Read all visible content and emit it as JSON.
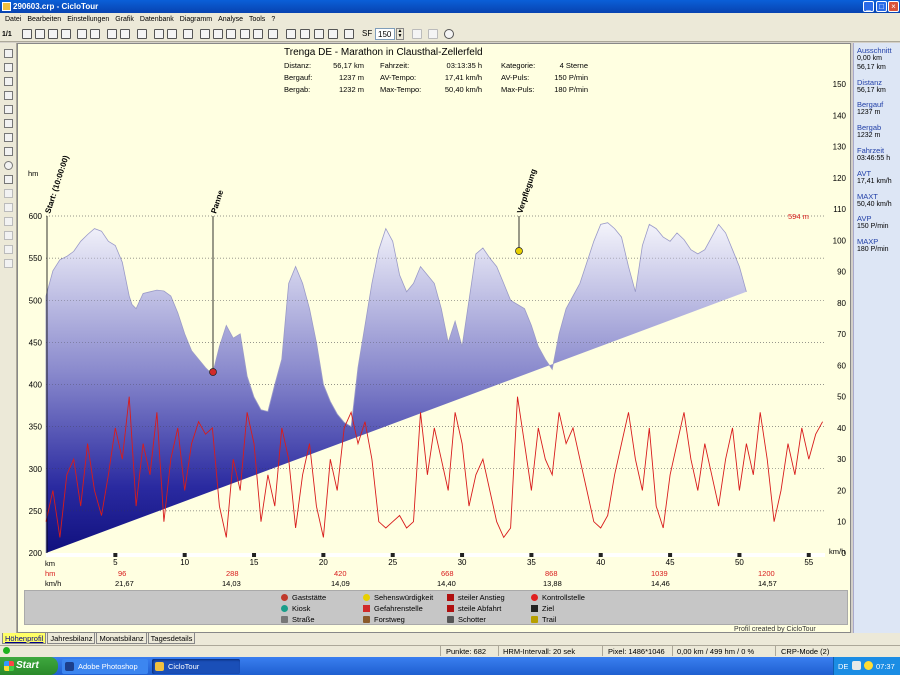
{
  "window": {
    "title": "290603.crp - CicloTour",
    "minimize_label": "_",
    "maximize_label": "□",
    "close_label": "×"
  },
  "menu": [
    "Datei",
    "Bearbeiten",
    "Einstellungen",
    "Grafik",
    "Datenbank",
    "Diagramm",
    "Analyse",
    "Tools",
    "?"
  ],
  "toolbar": {
    "page_counter": "1/1",
    "sf_label": "SF",
    "sf_value": "150"
  },
  "chart": {
    "title": "Trenga DE - Marathon in Clausthal-Zellerfeld",
    "stats": [
      {
        "label": "Distanz:",
        "value": "56,17 km"
      },
      {
        "label": "Bergauf:",
        "value": "1237 m"
      },
      {
        "label": "Bergab:",
        "value": "1232 m"
      },
      {
        "label": "Fahrzeit:",
        "value": "03:13:35 h"
      },
      {
        "label": "AV-Tempo:",
        "value": "17,41 km/h"
      },
      {
        "label": "Max-Tempo:",
        "value": "50,40 km/h"
      },
      {
        "label": "Kategorie:",
        "value": "4 Sterne"
      },
      {
        "label": "AV-Puls:",
        "value": "150 P/min"
      },
      {
        "label": "Max-Puls:",
        "value": "180 P/min"
      }
    ],
    "unit_hm": "hm",
    "unit_kmh": "km/h",
    "max_label": "594 m",
    "waypoints": [
      "Start: (10:00:00)",
      "Panne",
      "Verpflegung"
    ],
    "row_labels": {
      "km": "km",
      "hm": "hm",
      "kmh": "km/h"
    },
    "hm_row": [
      "96",
      "288",
      "420",
      "668",
      "868",
      "1039",
      "1200"
    ],
    "kmh_row": [
      "21,67",
      "14,03",
      "14,09",
      "14,40",
      "13,88",
      "14,46",
      "14,57"
    ]
  },
  "chart_data": {
    "type": "area",
    "x_unit": "km",
    "xlim": [
      0,
      56.17
    ],
    "x_ticks": [
      5,
      10,
      15,
      20,
      25,
      30,
      35,
      40,
      45,
      50,
      55
    ],
    "y_left_label": "hm",
    "y_left_ticks": [
      200,
      250,
      300,
      350,
      400,
      450,
      500,
      550,
      600
    ],
    "ylim_left": [
      200,
      600
    ],
    "y_right_label": "km/h",
    "y_right_ticks": [
      0,
      10,
      20,
      30,
      40,
      50,
      60,
      70,
      80,
      90,
      100,
      110,
      120,
      130,
      140,
      150
    ],
    "ylim_right": [
      0,
      150
    ],
    "grid": true,
    "elevation": {
      "x": [
        0,
        0.5,
        1,
        1.5,
        2,
        2.5,
        3,
        3.5,
        4,
        4.5,
        5,
        5.5,
        6,
        6.2,
        6.5,
        7,
        7.5,
        8,
        8.5,
        9,
        9.5,
        10,
        10.5,
        11,
        11.5,
        12,
        12.5,
        13,
        13.5,
        14,
        14.5,
        15,
        15.5,
        16,
        16.5,
        17,
        17.5,
        18,
        18.5,
        19,
        19.5,
        20,
        20.5,
        21,
        21.5,
        22,
        22.5,
        23,
        23.5,
        24,
        24.5,
        25,
        25.5,
        26,
        26.5,
        27,
        27.5,
        28,
        28.5,
        29,
        29.5,
        30,
        30.5,
        31,
        31.5,
        32,
        32.5,
        33,
        33.5,
        34,
        34.5,
        35,
        35.5,
        36,
        36.5,
        37,
        37.5,
        38,
        38.5,
        39,
        39.5,
        40,
        40.5,
        41,
        41.5,
        42,
        42.5,
        43,
        43.5,
        44,
        44.5,
        45,
        45.5,
        46,
        46.5,
        47,
        47.5,
        48,
        48.5,
        49,
        49.5,
        50,
        50.5,
        51,
        51.5,
        52,
        52.5,
        53,
        53.5,
        54,
        54.5,
        55,
        55.5,
        56,
        56.17
      ],
      "y": [
        505,
        535,
        548,
        552,
        558,
        570,
        578,
        585,
        582,
        570,
        565,
        545,
        505,
        495,
        490,
        508,
        510,
        512,
        511,
        505,
        485,
        460,
        440,
        430,
        420,
        412,
        445,
        470,
        455,
        460,
        410,
        385,
        370,
        368,
        400,
        430,
        520,
        540,
        520,
        490,
        450,
        400,
        380,
        365,
        355,
        350,
        420,
        470,
        520,
        560,
        585,
        570,
        530,
        510,
        520,
        540,
        530,
        520,
        490,
        450,
        475,
        445,
        500,
        555,
        562,
        550,
        540,
        520,
        500,
        495,
        490,
        470,
        445,
        430,
        418,
        460,
        490,
        505,
        520,
        545,
        570,
        590,
        592,
        585,
        575,
        540,
        510,
        565,
        590,
        585,
        575,
        570,
        580,
        572,
        560,
        555,
        560,
        575,
        590,
        580,
        560,
        540,
        510
      ]
    },
    "speed": {
      "x": [
        0,
        0.5,
        1,
        1.5,
        2,
        2.5,
        3,
        3.5,
        4,
        4.5,
        5,
        5.5,
        6,
        6.5,
        7,
        7.5,
        8,
        8.5,
        9,
        9.5,
        10,
        10.5,
        11,
        11.5,
        12,
        12.5,
        13,
        13.5,
        14,
        14.5,
        15,
        15.5,
        16,
        16.5,
        17,
        17.5,
        18,
        18.5,
        19,
        19.5,
        20,
        20.5,
        21,
        21.5,
        22,
        22.5,
        23,
        23.5,
        24,
        24.5,
        25,
        25.5,
        26,
        26.5,
        27,
        27.5,
        28,
        28.5,
        29,
        29.5,
        30,
        30.5,
        31,
        31.5,
        32,
        32.5,
        33,
        33.5,
        34,
        34.5,
        35,
        35.5,
        36,
        36.5,
        37,
        37.5,
        38,
        38.5,
        39,
        39.5,
        40,
        40.5,
        41,
        41.5,
        42,
        42.5,
        43,
        43.5,
        44,
        44.5,
        45,
        45.5,
        46,
        46.5,
        47,
        47.5,
        48,
        48.5,
        49,
        49.5,
        50,
        50.5,
        51,
        51.5,
        52,
        52.5,
        53,
        53.5,
        54,
        54.5,
        55,
        55.5,
        56
      ],
      "y": [
        10,
        20,
        5,
        25,
        30,
        15,
        35,
        20,
        12,
        25,
        40,
        30,
        50,
        15,
        35,
        25,
        45,
        10,
        30,
        40,
        20,
        35,
        42,
        38,
        40,
        15,
        5,
        30,
        20,
        45,
        35,
        10,
        25,
        15,
        40,
        30,
        8,
        25,
        35,
        15,
        5,
        30,
        20,
        40,
        45,
        35,
        42,
        30,
        10,
        8,
        10,
        12,
        8,
        10,
        45,
        25,
        40,
        30,
        20,
        45,
        35,
        15,
        25,
        30,
        20,
        10,
        5,
        8,
        50,
        35,
        20,
        40,
        30,
        25,
        45,
        35,
        40,
        30,
        20,
        10,
        8,
        12,
        25,
        35,
        45,
        30,
        20,
        40,
        15,
        8,
        25,
        35,
        45,
        30,
        20,
        35,
        25,
        15,
        30,
        40,
        20,
        35,
        25,
        45,
        30,
        10,
        20,
        35,
        25,
        40,
        30,
        38,
        42
      ]
    }
  },
  "right_panel": [
    {
      "label": "Ausschnitt",
      "values": [
        "0,00 km",
        "56,17 km"
      ]
    },
    {
      "label": "Distanz",
      "values": [
        "56,17 km"
      ]
    },
    {
      "label": "Bergauf",
      "values": [
        "1237 m"
      ]
    },
    {
      "label": "Bergab",
      "values": [
        "1232 m"
      ]
    },
    {
      "label": "Fahrzeit",
      "values": [
        "03:46:55 h"
      ]
    },
    {
      "label": "AVT",
      "values": [
        "17,41 km/h"
      ]
    },
    {
      "label": "MAXT",
      "values": [
        "50,40 km/h"
      ]
    },
    {
      "label": "AVP",
      "values": [
        "150 P/min"
      ]
    },
    {
      "label": "MAXP",
      "values": [
        "180 P/min"
      ]
    }
  ],
  "legend": [
    {
      "label": "Gaststätte",
      "color": "#c0392b"
    },
    {
      "label": "Kiosk",
      "color": "#1a9e8a"
    },
    {
      "label": "Straße",
      "color": "#777777"
    },
    {
      "label": "Sehenswürdigkeit",
      "color": "#e8d000"
    },
    {
      "label": "Gefahrenstelle",
      "color": "#d12a2a"
    },
    {
      "label": "Forstweg",
      "color": "#8b5a2b"
    },
    {
      "label": "steiler Anstieg",
      "color": "#b01010"
    },
    {
      "label": "steile Abfahrt",
      "color": "#b01010"
    },
    {
      "label": "Schotter",
      "color": "#555555"
    },
    {
      "label": "Kontrollstelle",
      "color": "#e02020"
    },
    {
      "label": "Ziel",
      "color": "#222222"
    },
    {
      "label": "Trail",
      "color": "#b8a000"
    }
  ],
  "profile_credit": "Profil created by CicloTour",
  "tabs": [
    "Höhenprofil",
    "Jahresbilanz",
    "Monatsbilanz",
    "Tagesdetails"
  ],
  "status": {
    "punkte": "Punkte: 682",
    "hrm": "HRM-Intervall: 20 sek",
    "pixel": "Pixel: 1486*1046",
    "zoom": "0,00 km / 499 hm / 0 %",
    "mode": "CRP-Mode (2)"
  },
  "taskbar": {
    "start": "Start",
    "tasks": [
      "Adobe Photoshop",
      "CicloTour"
    ],
    "lang": "DE",
    "clock": "07:37"
  }
}
